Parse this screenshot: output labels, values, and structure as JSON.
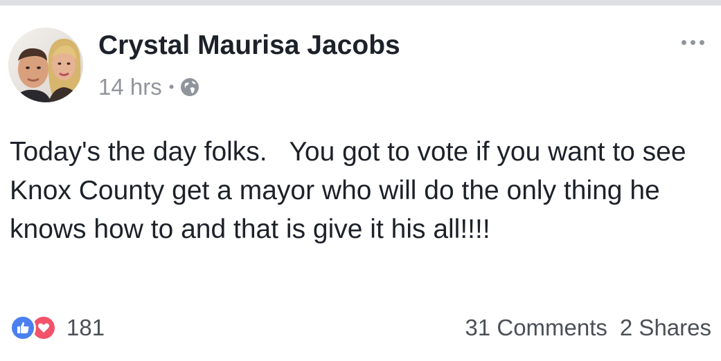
{
  "post": {
    "author_name": "Crystal Maurisa Jacobs",
    "timestamp": "14 hrs",
    "separator": "•",
    "privacy_icon": "globe-icon",
    "more_icon": "more-options-icon",
    "text": "Today's the day folks.   You got to vote if you want to see Knox County get a mayor who will do the only thing he knows how to and that is give it his all!!!!"
  },
  "footer": {
    "reaction_icons": [
      "like-icon",
      "love-icon"
    ],
    "reaction_count": "181",
    "comments_label": "31 Comments",
    "shares_label": "2 Shares"
  },
  "colors": {
    "like": "#4a80f0",
    "love": "#f2526a",
    "meta_gray": "#90949c",
    "text": "#1d2129"
  }
}
